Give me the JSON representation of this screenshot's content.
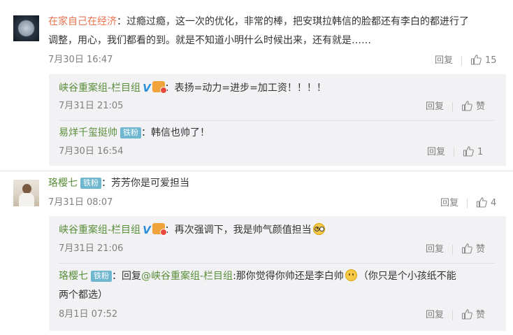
{
  "comments": [
    {
      "user": "在家自己在经济",
      "text": "：过瘾过瘾，这一次的优化，非常的棒，把安琪拉韩信的脸都还有李白的都进行了",
      "text2": "调整，用心，我们都看的到。就是不知道小明什么时候出来，还有就是……",
      "time": "7月30日 16:47",
      "reply_label": "回复",
      "likes": "15",
      "replies": [
        {
          "user": "峡谷重案组-栏目组",
          "text": "：表扬=动力=进步=加工资！！！！",
          "time": "7月31日 21:05",
          "reply_label": "回复",
          "like_label": "赞"
        },
        {
          "user": "易烊千玺挺帅",
          "fan_badge": "铁粉",
          "text": "：韩信也帅了！",
          "time": "7月30日 16:54",
          "reply_label": "回复",
          "likes": "1"
        }
      ]
    },
    {
      "user": "珞樱七",
      "fan_badge": "铁粉",
      "text": "：芳芳你是可爱担当",
      "time": "7月31日 08:07",
      "reply_label": "回复",
      "likes": "4",
      "replies": [
        {
          "user": "峡谷重案组-栏目组",
          "text": "：再次强调下，我是帅气颜值担当",
          "time": "7月31日 21:06",
          "reply_label": "回复",
          "like_label": "赞"
        },
        {
          "user": "珞樱七",
          "fan_badge": "铁粉",
          "text_prefix": "：回复",
          "mention": "@峡谷重案组-栏目组",
          "text_mid": ":那你觉得你帅还是李白帅",
          "text_suffix": "（你只是个小孩纸不能",
          "text2": "两个都选）",
          "time": "8月1日 07:52",
          "reply_label": "回复",
          "like_label": "赞"
        }
      ]
    }
  ],
  "icons": {
    "thumb": "thumbs-up-icon",
    "verified": "verified-v-icon",
    "avatar1": "moon-avatar",
    "avatar2": "person-avatar"
  },
  "colors": {
    "username": "#eb7350",
    "reply_username": "#5a8e3a",
    "fan_badge": "#6fb7cf",
    "reply_bg": "#f2f2f5"
  }
}
